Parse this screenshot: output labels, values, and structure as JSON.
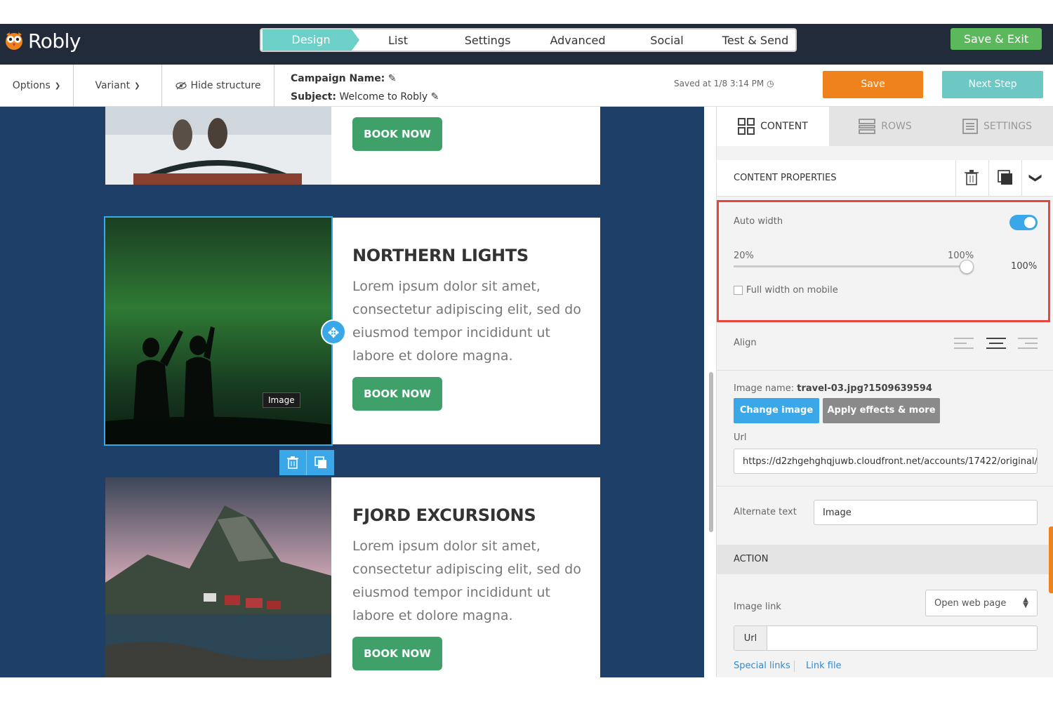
{
  "app": {
    "logo_text": "Robly",
    "save_exit_label": "Save & Exit"
  },
  "steps": [
    {
      "label": "Design",
      "active": true
    },
    {
      "label": "List"
    },
    {
      "label": "Settings"
    },
    {
      "label": "Advanced"
    },
    {
      "label": "Social"
    },
    {
      "label": "Test & Send"
    }
  ],
  "toolbar": {
    "options_label": "Options",
    "variant_label": "Variant",
    "hide_structure_label": "Hide structure",
    "campaign_name_label": "Campaign Name:",
    "subject_label": "Subject:",
    "subject_value": "Welcome to Robly",
    "saved_at": "Saved at 1/8 3:14 PM",
    "save_label": "Save",
    "next_step_label": "Next Step"
  },
  "email": {
    "blocks": [
      {
        "book_label": "BOOK NOW"
      },
      {
        "title": "NORTHERN LIGHTS",
        "body": "Lorem ipsum dolor sit amet, consectetur adipiscing elit, sed do eiusmod tempor incididunt ut labore et dolore magna.",
        "book_label": "BOOK NOW",
        "image_tooltip": "Image"
      },
      {
        "title": "FJORD EXCURSIONS",
        "body": "Lorem ipsum dolor sit amet, consectetur adipiscing elit, sed do eiusmod tempor incididunt ut labore et dolore magna.",
        "book_label": "BOOK NOW"
      }
    ]
  },
  "panel": {
    "tabs": [
      {
        "label": "CONTENT",
        "icon": "grid-icon",
        "active": true
      },
      {
        "label": "ROWS",
        "icon": "rows-icon"
      },
      {
        "label": "SETTINGS",
        "icon": "settings-doc-icon"
      }
    ],
    "content_properties_label": "CONTENT PROPERTIES",
    "auto_width_label": "Auto width",
    "auto_width_on": true,
    "slider_min_label": "20%",
    "slider_max_label": "100%",
    "slider_value_label": "100%",
    "slider_value": 1.0,
    "full_width_mobile_label": "Full width on mobile",
    "align_label": "Align",
    "image_name_label": "Image name:",
    "image_name_value": "travel-03.jpg?1509639594",
    "change_image_label": "Change image",
    "apply_effects_label": "Apply effects & more",
    "url_label": "Url",
    "url_value": "https://d2zhgehghqjuwb.cloudfront.net/accounts/17422/original/",
    "alt_text_label": "Alternate text",
    "alt_text_value": "Image",
    "action_label": "ACTION",
    "image_link_label": "Image link",
    "image_link_option": "Open web page",
    "url_prefix_label": "Url",
    "url_link_value": "",
    "special_links_label": "Special links",
    "link_file_label": "Link file"
  },
  "colors": {
    "topbar": "#222b3a",
    "accent_teal": "#6ccfc8",
    "save_orange": "#f0821e",
    "book_green": "#3fa06a",
    "canvas_navy": "#1e4068",
    "highlight_red": "#e8463c",
    "link_blue": "#2a8bd8"
  }
}
